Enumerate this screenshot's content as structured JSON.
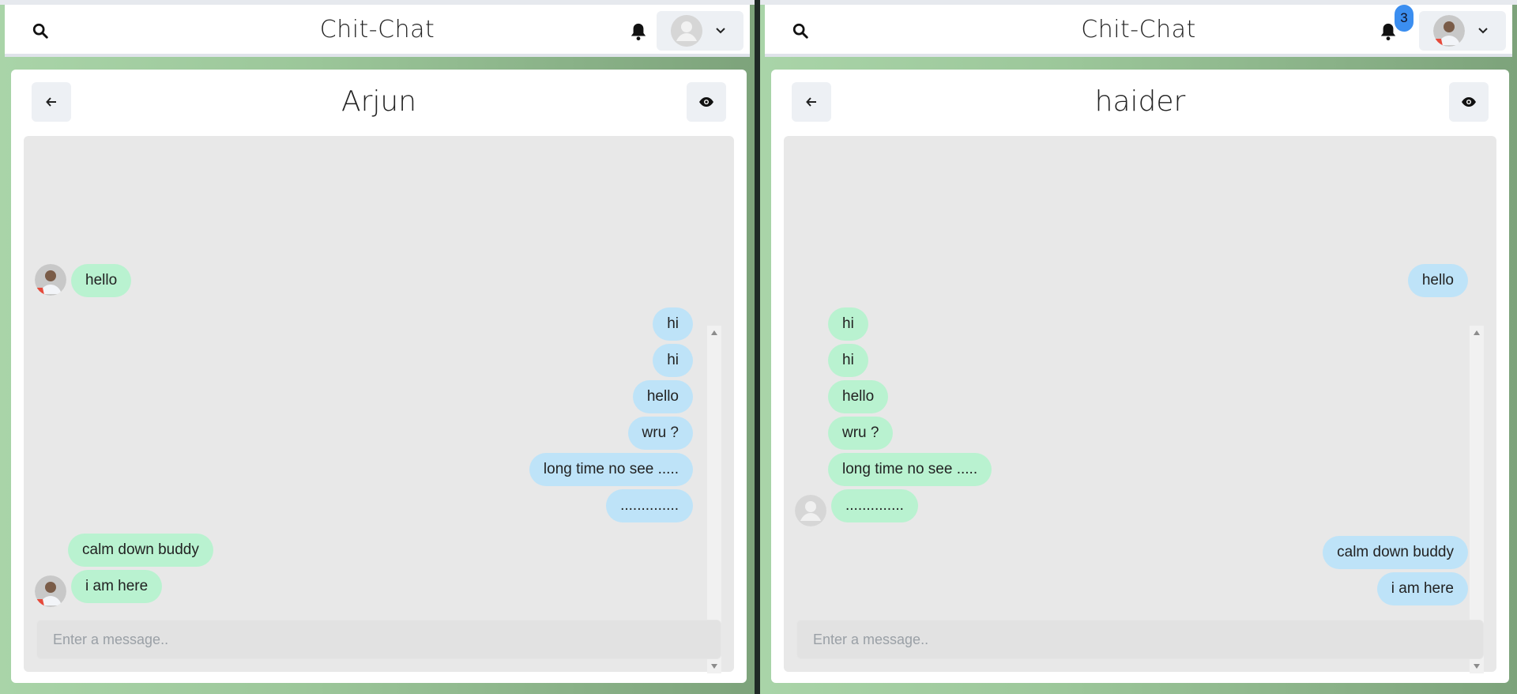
{
  "app": {
    "title": "Chit-Chat"
  },
  "left": {
    "chat_name": "Arjun",
    "input_placeholder": "Enter a message..",
    "messages": [
      {
        "text": "hello",
        "side": "received",
        "color": "green",
        "avatar": "user-photo"
      },
      {
        "text": "hi",
        "side": "sent",
        "color": "blue"
      },
      {
        "text": "hi",
        "side": "sent",
        "color": "blue"
      },
      {
        "text": "hello",
        "side": "sent",
        "color": "blue"
      },
      {
        "text": "wru ?",
        "side": "sent",
        "color": "blue"
      },
      {
        "text": "long time no see .....",
        "side": "sent",
        "color": "blue"
      },
      {
        "text": "..............",
        "side": "sent",
        "color": "blue"
      },
      {
        "text": "calm down buddy",
        "side": "received",
        "color": "green"
      },
      {
        "text": "i am here",
        "side": "received",
        "color": "green",
        "avatar": "user-photo"
      }
    ]
  },
  "right": {
    "chat_name": "haider",
    "notification_count": "3",
    "input_placeholder": "Enter a message..",
    "messages": [
      {
        "text": "hello",
        "side": "sent",
        "color": "blue"
      },
      {
        "text": "hi",
        "side": "received",
        "color": "green"
      },
      {
        "text": "hi",
        "side": "received",
        "color": "green"
      },
      {
        "text": "hello",
        "side": "received",
        "color": "green"
      },
      {
        "text": "wru ?",
        "side": "received",
        "color": "green"
      },
      {
        "text": "long time no see .....",
        "side": "received",
        "color": "green"
      },
      {
        "text": "..............",
        "side": "received",
        "color": "green",
        "avatar": "default-avatar"
      },
      {
        "text": "calm down buddy",
        "side": "sent",
        "color": "blue"
      },
      {
        "text": "i am here",
        "side": "sent",
        "color": "blue"
      }
    ]
  },
  "colors": {
    "sent_bubble_left": "#bee3f8",
    "received_bubble": "#b9f2d0",
    "badge": "#3b8ef0"
  },
  "icons": [
    "search-icon",
    "bell-icon",
    "chevron-down-icon",
    "arrow-left-icon",
    "eye-icon",
    "avatar-icon"
  ]
}
